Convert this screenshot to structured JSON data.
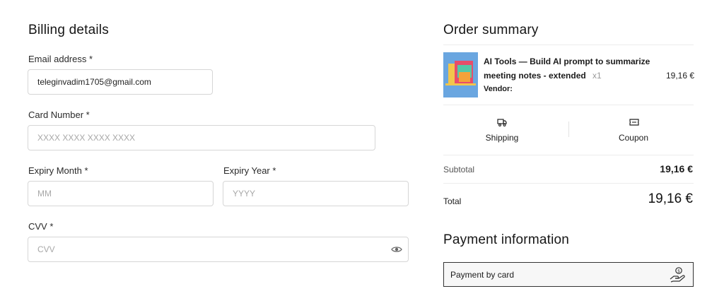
{
  "billing": {
    "title": "Billing details",
    "email": {
      "label": "Email address *",
      "value": "teleginvadim1705@gmail.com"
    },
    "card_number": {
      "label": "Card Number *",
      "placeholder": "XXXX XXXX XXXX XXXX"
    },
    "expiry_month": {
      "label": "Expiry Month *",
      "placeholder": "MM"
    },
    "expiry_year": {
      "label": "Expiry Year *",
      "placeholder": "YYYY"
    },
    "cvv": {
      "label": "CVV *",
      "placeholder": "CVV"
    }
  },
  "summary": {
    "title": "Order summary",
    "item": {
      "name_line1": "AI Tools — Build AI prompt to summarize",
      "name_line2": "meeting notes - extended",
      "qty": "x1",
      "vendor": "Vendor:",
      "price": "19,16 €"
    },
    "shipping_label": "Shipping",
    "coupon_label": "Coupon",
    "subtotal_label": "Subtotal",
    "subtotal_value": "19,16 €",
    "total_label": "Total",
    "total_value": "19,16 €"
  },
  "payment": {
    "title": "Payment information",
    "option_label": "Payment by card"
  },
  "icons": {
    "cvv_toggle": "eye-icon",
    "shipping": "truck-icon",
    "coupon": "ticket-icon",
    "payment": "hand-coin-icon"
  }
}
